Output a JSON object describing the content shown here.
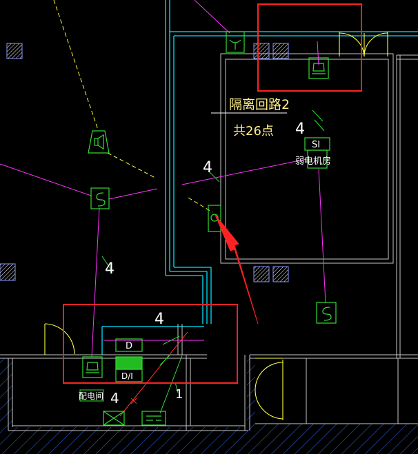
{
  "colors": {
    "background": "#000000",
    "wall": "#00e5ff",
    "wall_inner": "#c8c8c8",
    "device": "#33dd33",
    "wire_magenta": "#ff33ff",
    "dashed_yellow": "#ffff33",
    "label_white": "#ffffff",
    "label_yellow": "#ffee88",
    "highlight_red": "#ff2222",
    "arrow_red": "#ff2222",
    "hatch_blue": "#2b5cc8",
    "door_yellow": "#ffff44"
  },
  "annotations": {
    "circuit_title": "隔离回路2",
    "point_count": "共26点",
    "room_label_weak": "弱电机房",
    "room_label_distribution": "配电间",
    "device_si": "SI",
    "device_d": "D",
    "device_d_slash_i": "D/I",
    "wire_count_4": "4",
    "wire_count_1": "1"
  },
  "icons": {
    "switch": "s-switch-icon",
    "sensor": "sensor-icon",
    "speaker": "speaker-icon",
    "box": "cross-box-icon"
  }
}
